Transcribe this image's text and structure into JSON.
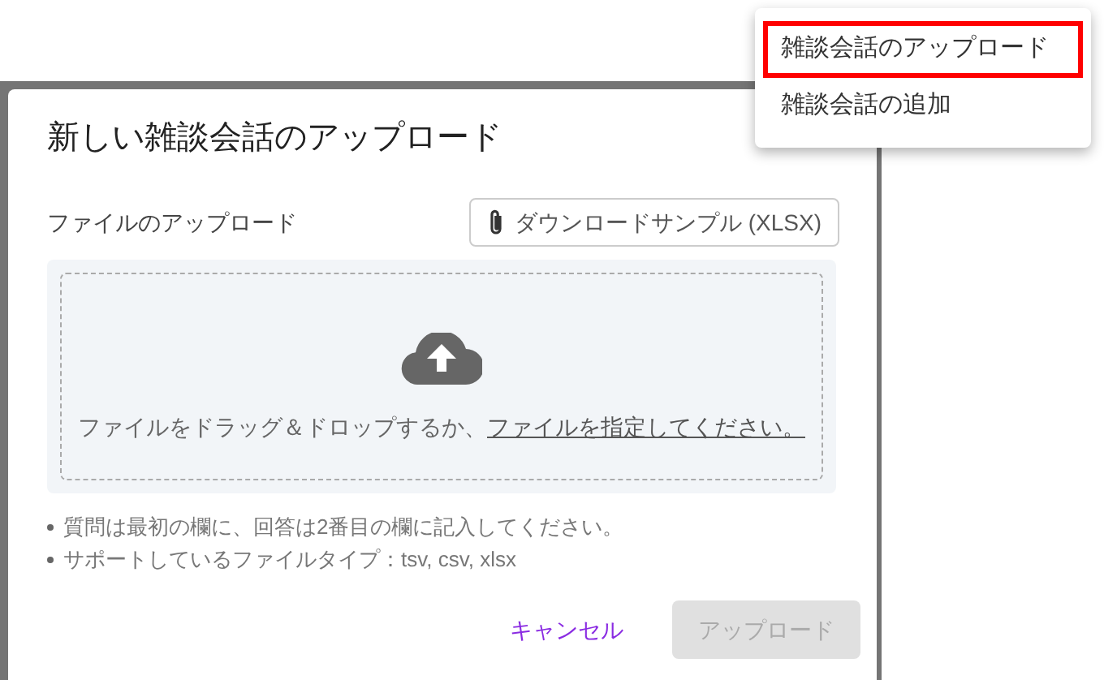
{
  "dialog": {
    "title": "新しい雑談会話のアップロード",
    "section_label": "ファイルのアップロード",
    "sample_button": "ダウンロードサンプル (XLSX)",
    "dropzone": {
      "text": "ファイルをドラッグ＆ドロップするか、",
      "link": "ファイルを指定してください。"
    },
    "notes": [
      "質問は最初の欄に、回答は2番目の欄に記入してください。",
      "サポートしているファイルタイプ：tsv, csv, xlsx"
    ],
    "buttons": [
      {
        "label": "キャンセル",
        "kind": "text",
        "disabled": false
      },
      {
        "label": "アップロード",
        "kind": "contained",
        "disabled": true
      }
    ]
  },
  "menu": {
    "items": [
      {
        "label": "雑談会話のアップロード",
        "selected": true
      },
      {
        "label": "雑談会話の追加",
        "selected": false
      }
    ]
  }
}
